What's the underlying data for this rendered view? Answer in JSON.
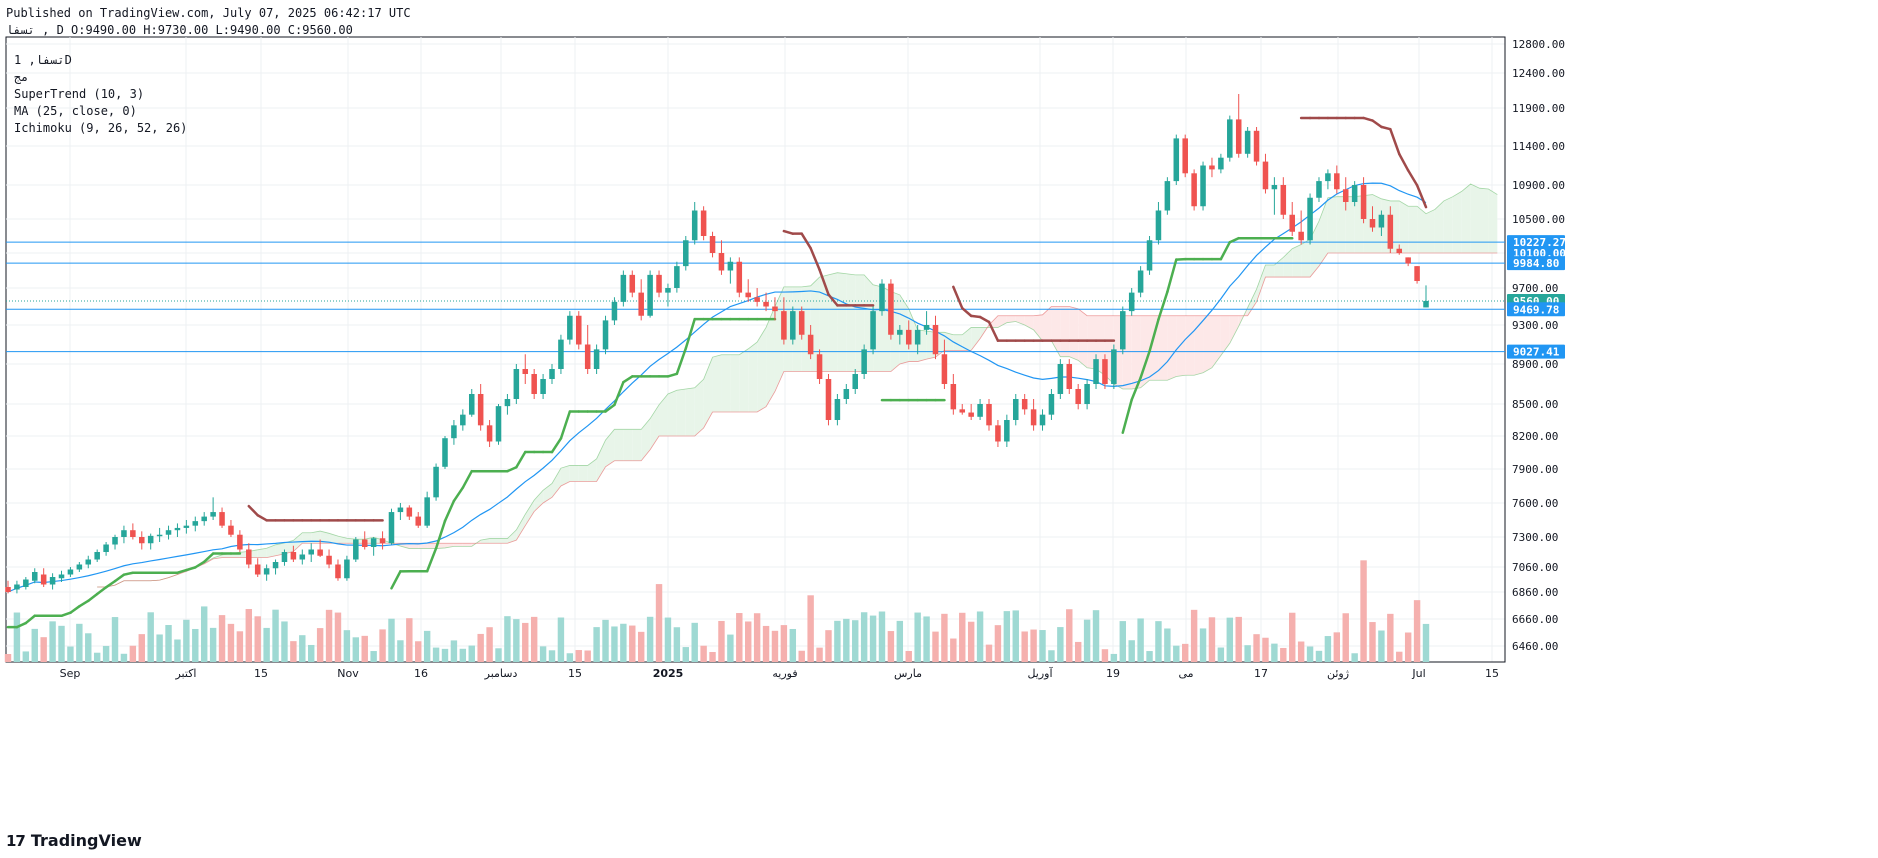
{
  "header": {
    "published": "Published on TradingView.com, July 07, 2025 06:42:17 UTC",
    "ohlc_line": "تسفا , D O:9490.00 H:9730.00 L:9490.00 C:9560.00"
  },
  "legend": {
    "symbol": "تسفا, 1D",
    "exchange": "مج",
    "supertrend": "SuperTrend (10, 3)",
    "ma": "MA (25, close, 0)",
    "ichimoku": "Ichimoku (9, 26, 52, 26)"
  },
  "footer": {
    "logo_mark": "17",
    "logo_text": "TradingView"
  },
  "colors": {
    "up": "#26a69a",
    "down": "#ef5350",
    "supertrend_up": "#4caf50",
    "supertrend_down": "#a04a4a",
    "ma": "#2196f3",
    "cloud_bull": "#e8f5e9",
    "cloud_bear": "#fde8e8",
    "level_line": "#2196f3",
    "grid": "#eef0f3"
  },
  "chart_data": {
    "type": "candlestick",
    "y_ticks": [
      "12800.00",
      "12400.00",
      "11900.00",
      "11400.00",
      "10900.00",
      "10500.00",
      "10100.00",
      "9700.00",
      "9300.00",
      "8900.00",
      "8500.00",
      "8200.00",
      "7900.00",
      "7600.00",
      "7300.00",
      "7060.00",
      "6860.00",
      "6660.00",
      "6460.00"
    ],
    "x_labels": [
      "Sep",
      "اکتبر",
      "15",
      "Nov",
      "16",
      "دسامبر",
      "15",
      "2025",
      "فوریه",
      "مارس",
      "آوریل",
      "19",
      "می",
      "17",
      "ژوئن",
      "Jul",
      "15"
    ],
    "price_labels": [
      {
        "value": "10227.27",
        "color": "#2196f3"
      },
      {
        "value": "10100.00",
        "color": "#2196f3"
      },
      {
        "value": "9984.80",
        "color": "#2196f3"
      },
      {
        "value": "9560.00",
        "color": "#26a69a"
      },
      {
        "value": "9469.78",
        "color": "#2196f3"
      },
      {
        "value": "9027.41",
        "color": "#2196f3"
      }
    ],
    "horizontal_levels": [
      10227.27,
      9984.8,
      9469.78,
      9027.41
    ],
    "last_close": 9560.0,
    "candles": [
      {
        "o": 6900,
        "h": 6950,
        "l": 6850,
        "c": 6860
      },
      {
        "o": 6880,
        "h": 6950,
        "l": 6850,
        "c": 6920
      },
      {
        "o": 6900,
        "h": 6980,
        "l": 6880,
        "c": 6960
      },
      {
        "o": 6950,
        "h": 7050,
        "l": 6930,
        "c": 7020
      },
      {
        "o": 7000,
        "h": 7050,
        "l": 6900,
        "c": 6920
      },
      {
        "o": 6920,
        "h": 7010,
        "l": 6880,
        "c": 6980
      },
      {
        "o": 6970,
        "h": 7030,
        "l": 6940,
        "c": 7000
      },
      {
        "o": 7000,
        "h": 7060,
        "l": 6980,
        "c": 7040
      },
      {
        "o": 7040,
        "h": 7100,
        "l": 7020,
        "c": 7080
      },
      {
        "o": 7080,
        "h": 7150,
        "l": 7050,
        "c": 7120
      },
      {
        "o": 7120,
        "h": 7200,
        "l": 7100,
        "c": 7180
      },
      {
        "o": 7180,
        "h": 7260,
        "l": 7150,
        "c": 7240
      },
      {
        "o": 7240,
        "h": 7320,
        "l": 7200,
        "c": 7300
      },
      {
        "o": 7300,
        "h": 7400,
        "l": 7250,
        "c": 7360
      },
      {
        "o": 7360,
        "h": 7420,
        "l": 7280,
        "c": 7300
      },
      {
        "o": 7300,
        "h": 7350,
        "l": 7200,
        "c": 7250
      },
      {
        "o": 7250,
        "h": 7330,
        "l": 7200,
        "c": 7310
      },
      {
        "o": 7310,
        "h": 7380,
        "l": 7260,
        "c": 7320
      },
      {
        "o": 7320,
        "h": 7400,
        "l": 7280,
        "c": 7360
      },
      {
        "o": 7360,
        "h": 7420,
        "l": 7300,
        "c": 7380
      },
      {
        "o": 7380,
        "h": 7450,
        "l": 7330,
        "c": 7400
      },
      {
        "o": 7400,
        "h": 7480,
        "l": 7350,
        "c": 7440
      },
      {
        "o": 7440,
        "h": 7520,
        "l": 7400,
        "c": 7480
      },
      {
        "o": 7480,
        "h": 7650,
        "l": 7450,
        "c": 7520
      },
      {
        "o": 7520,
        "h": 7560,
        "l": 7380,
        "c": 7400
      },
      {
        "o": 7400,
        "h": 7450,
        "l": 7300,
        "c": 7320
      },
      {
        "o": 7320,
        "h": 7360,
        "l": 7180,
        "c": 7200
      },
      {
        "o": 7200,
        "h": 7250,
        "l": 7050,
        "c": 7080
      },
      {
        "o": 7080,
        "h": 7130,
        "l": 6980,
        "c": 7000
      },
      {
        "o": 7000,
        "h": 7080,
        "l": 6950,
        "c": 7050
      },
      {
        "o": 7050,
        "h": 7120,
        "l": 7000,
        "c": 7100
      },
      {
        "o": 7100,
        "h": 7200,
        "l": 7070,
        "c": 7180
      },
      {
        "o": 7180,
        "h": 7230,
        "l": 7100,
        "c": 7120
      },
      {
        "o": 7120,
        "h": 7200,
        "l": 7080,
        "c": 7160
      },
      {
        "o": 7160,
        "h": 7250,
        "l": 7100,
        "c": 7200
      },
      {
        "o": 7200,
        "h": 7280,
        "l": 7140,
        "c": 7150
      },
      {
        "o": 7150,
        "h": 7200,
        "l": 7050,
        "c": 7080
      },
      {
        "o": 7080,
        "h": 7120,
        "l": 6950,
        "c": 6970
      },
      {
        "o": 6970,
        "h": 7150,
        "l": 6950,
        "c": 7120
      },
      {
        "o": 7120,
        "h": 7300,
        "l": 7100,
        "c": 7280
      },
      {
        "o": 7280,
        "h": 7350,
        "l": 7200,
        "c": 7220
      },
      {
        "o": 7220,
        "h": 7300,
        "l": 7150,
        "c": 7290
      },
      {
        "o": 7290,
        "h": 7350,
        "l": 7200,
        "c": 7250
      },
      {
        "o": 7250,
        "h": 7550,
        "l": 7240,
        "c": 7520
      },
      {
        "o": 7520,
        "h": 7600,
        "l": 7450,
        "c": 7560
      },
      {
        "o": 7560,
        "h": 7580,
        "l": 7450,
        "c": 7480
      },
      {
        "o": 7480,
        "h": 7520,
        "l": 7380,
        "c": 7400
      },
      {
        "o": 7400,
        "h": 7700,
        "l": 7380,
        "c": 7650
      },
      {
        "o": 7650,
        "h": 7950,
        "l": 7620,
        "c": 7920
      },
      {
        "o": 7920,
        "h": 8200,
        "l": 7900,
        "c": 8180
      },
      {
        "o": 8180,
        "h": 8350,
        "l": 8120,
        "c": 8300
      },
      {
        "o": 8300,
        "h": 8450,
        "l": 8250,
        "c": 8400
      },
      {
        "o": 8400,
        "h": 8650,
        "l": 8380,
        "c": 8600
      },
      {
        "o": 8600,
        "h": 8700,
        "l": 8250,
        "c": 8300
      },
      {
        "o": 8300,
        "h": 8350,
        "l": 8100,
        "c": 8150
      },
      {
        "o": 8150,
        "h": 8500,
        "l": 8120,
        "c": 8480
      },
      {
        "o": 8480,
        "h": 8600,
        "l": 8400,
        "c": 8550
      },
      {
        "o": 8550,
        "h": 8900,
        "l": 8500,
        "c": 8850
      },
      {
        "o": 8850,
        "h": 9000,
        "l": 8700,
        "c": 8800
      },
      {
        "o": 8800,
        "h": 8850,
        "l": 8550,
        "c": 8600
      },
      {
        "o": 8600,
        "h": 8800,
        "l": 8550,
        "c": 8750
      },
      {
        "o": 8750,
        "h": 8900,
        "l": 8700,
        "c": 8850
      },
      {
        "o": 8850,
        "h": 9200,
        "l": 8800,
        "c": 9150
      },
      {
        "o": 9150,
        "h": 9450,
        "l": 9100,
        "c": 9400
      },
      {
        "o": 9400,
        "h": 9450,
        "l": 9050,
        "c": 9100
      },
      {
        "o": 9100,
        "h": 9300,
        "l": 8800,
        "c": 8850
      },
      {
        "o": 8850,
        "h": 9100,
        "l": 8800,
        "c": 9050
      },
      {
        "o": 9050,
        "h": 9400,
        "l": 9000,
        "c": 9350
      },
      {
        "o": 9350,
        "h": 9600,
        "l": 9300,
        "c": 9550
      },
      {
        "o": 9550,
        "h": 9900,
        "l": 9500,
        "c": 9850
      },
      {
        "o": 9850,
        "h": 9900,
        "l": 9600,
        "c": 9650
      },
      {
        "o": 9650,
        "h": 9800,
        "l": 9350,
        "c": 9400
      },
      {
        "o": 9400,
        "h": 9900,
        "l": 9380,
        "c": 9850
      },
      {
        "o": 9850,
        "h": 9900,
        "l": 9600,
        "c": 9650
      },
      {
        "o": 9650,
        "h": 9750,
        "l": 9500,
        "c": 9700
      },
      {
        "o": 9700,
        "h": 10000,
        "l": 9650,
        "c": 9950
      },
      {
        "o": 9950,
        "h": 10300,
        "l": 9900,
        "c": 10250
      },
      {
        "o": 10250,
        "h": 10700,
        "l": 10200,
        "c": 10600
      },
      {
        "o": 10600,
        "h": 10650,
        "l": 10250,
        "c": 10300
      },
      {
        "o": 10300,
        "h": 10350,
        "l": 10050,
        "c": 10100
      },
      {
        "o": 10100,
        "h": 10250,
        "l": 9850,
        "c": 9900
      },
      {
        "o": 9900,
        "h": 10050,
        "l": 9750,
        "c": 10000
      },
      {
        "o": 10000,
        "h": 10050,
        "l": 9600,
        "c": 9650
      },
      {
        "o": 9650,
        "h": 9800,
        "l": 9550,
        "c": 9600
      },
      {
        "o": 9600,
        "h": 9700,
        "l": 9500,
        "c": 9550
      },
      {
        "o": 9550,
        "h": 9650,
        "l": 9450,
        "c": 9500
      },
      {
        "o": 9500,
        "h": 9600,
        "l": 9350,
        "c": 9450
      },
      {
        "o": 9450,
        "h": 9600,
        "l": 9100,
        "c": 9150
      },
      {
        "o": 9150,
        "h": 9500,
        "l": 9100,
        "c": 9450
      },
      {
        "o": 9450,
        "h": 9500,
        "l": 9150,
        "c": 9200
      },
      {
        "o": 9200,
        "h": 9300,
        "l": 8950,
        "c": 9000
      },
      {
        "o": 9000,
        "h": 9050,
        "l": 8700,
        "c": 8750
      },
      {
        "o": 8750,
        "h": 8800,
        "l": 8300,
        "c": 8350
      },
      {
        "o": 8350,
        "h": 8600,
        "l": 8300,
        "c": 8550
      },
      {
        "o": 8550,
        "h": 8700,
        "l": 8500,
        "c": 8650
      },
      {
        "o": 8650,
        "h": 8850,
        "l": 8600,
        "c": 8800
      },
      {
        "o": 8800,
        "h": 9100,
        "l": 8750,
        "c": 9050
      },
      {
        "o": 9050,
        "h": 9500,
        "l": 9000,
        "c": 9450
      },
      {
        "o": 9450,
        "h": 9800,
        "l": 9400,
        "c": 9750
      },
      {
        "o": 9750,
        "h": 9800,
        "l": 9150,
        "c": 9200
      },
      {
        "o": 9200,
        "h": 9300,
        "l": 9100,
        "c": 9250
      },
      {
        "o": 9250,
        "h": 9350,
        "l": 9050,
        "c": 9100
      },
      {
        "o": 9100,
        "h": 9300,
        "l": 9000,
        "c": 9250
      },
      {
        "o": 9250,
        "h": 9450,
        "l": 9200,
        "c": 9300
      },
      {
        "o": 9300,
        "h": 9400,
        "l": 8950,
        "c": 9000
      },
      {
        "o": 9000,
        "h": 9150,
        "l": 8650,
        "c": 8700
      },
      {
        "o": 8700,
        "h": 8800,
        "l": 8400,
        "c": 8450
      },
      {
        "o": 8450,
        "h": 8500,
        "l": 8400,
        "c": 8420
      },
      {
        "o": 8420,
        "h": 8500,
        "l": 8350,
        "c": 8380
      },
      {
        "o": 8380,
        "h": 8550,
        "l": 8350,
        "c": 8500
      },
      {
        "o": 8500,
        "h": 8550,
        "l": 8250,
        "c": 8300
      },
      {
        "o": 8300,
        "h": 8350,
        "l": 8100,
        "c": 8150
      },
      {
        "o": 8150,
        "h": 8400,
        "l": 8100,
        "c": 8350
      },
      {
        "o": 8350,
        "h": 8600,
        "l": 8300,
        "c": 8550
      },
      {
        "o": 8550,
        "h": 8600,
        "l": 8400,
        "c": 8450
      },
      {
        "o": 8450,
        "h": 8550,
        "l": 8250,
        "c": 8300
      },
      {
        "o": 8300,
        "h": 8450,
        "l": 8250,
        "c": 8400
      },
      {
        "o": 8400,
        "h": 8650,
        "l": 8350,
        "c": 8600
      },
      {
        "o": 8600,
        "h": 8950,
        "l": 8550,
        "c": 8900
      },
      {
        "o": 8900,
        "h": 8950,
        "l": 8600,
        "c": 8650
      },
      {
        "o": 8650,
        "h": 8700,
        "l": 8450,
        "c": 8500
      },
      {
        "o": 8500,
        "h": 8750,
        "l": 8450,
        "c": 8700
      },
      {
        "o": 8700,
        "h": 9000,
        "l": 8650,
        "c": 8950
      },
      {
        "o": 8950,
        "h": 9000,
        "l": 8650,
        "c": 8700
      },
      {
        "o": 8700,
        "h": 9100,
        "l": 8650,
        "c": 9050
      },
      {
        "o": 9050,
        "h": 9500,
        "l": 9000,
        "c": 9450
      },
      {
        "o": 9450,
        "h": 9700,
        "l": 9400,
        "c": 9650
      },
      {
        "o": 9650,
        "h": 9950,
        "l": 9600,
        "c": 9900
      },
      {
        "o": 9900,
        "h": 10300,
        "l": 9850,
        "c": 10250
      },
      {
        "o": 10250,
        "h": 10700,
        "l": 10200,
        "c": 10600
      },
      {
        "o": 10600,
        "h": 11000,
        "l": 10550,
        "c": 10950
      },
      {
        "o": 10950,
        "h": 11550,
        "l": 10900,
        "c": 11500
      },
      {
        "o": 11500,
        "h": 11550,
        "l": 11000,
        "c": 11050
      },
      {
        "o": 11050,
        "h": 11100,
        "l": 10600,
        "c": 10650
      },
      {
        "o": 10650,
        "h": 11200,
        "l": 10600,
        "c": 11150
      },
      {
        "o": 11150,
        "h": 11250,
        "l": 11000,
        "c": 11100
      },
      {
        "o": 11100,
        "h": 11300,
        "l": 11050,
        "c": 11250
      },
      {
        "o": 11250,
        "h": 11800,
        "l": 11200,
        "c": 11750
      },
      {
        "o": 11750,
        "h": 12100,
        "l": 11250,
        "c": 11300
      },
      {
        "o": 11300,
        "h": 11650,
        "l": 11250,
        "c": 11600
      },
      {
        "o": 11600,
        "h": 11650,
        "l": 11150,
        "c": 11200
      },
      {
        "o": 11200,
        "h": 11300,
        "l": 10800,
        "c": 10850
      },
      {
        "o": 10850,
        "h": 11000,
        "l": 10550,
        "c": 10900
      },
      {
        "o": 10900,
        "h": 11000,
        "l": 10500,
        "c": 10550
      },
      {
        "o": 10550,
        "h": 10700,
        "l": 10300,
        "c": 10350
      },
      {
        "o": 10350,
        "h": 10600,
        "l": 10200,
        "c": 10250
      },
      {
        "o": 10250,
        "h": 10800,
        "l": 10200,
        "c": 10750
      },
      {
        "o": 10750,
        "h": 11000,
        "l": 10700,
        "c": 10950
      },
      {
        "o": 10950,
        "h": 11100,
        "l": 10850,
        "c": 11050
      },
      {
        "o": 11050,
        "h": 11150,
        "l": 10800,
        "c": 10850
      },
      {
        "o": 10850,
        "h": 11000,
        "l": 10600,
        "c": 10700
      },
      {
        "o": 10700,
        "h": 10950,
        "l": 10650,
        "c": 10900
      },
      {
        "o": 10900,
        "h": 11000,
        "l": 10450,
        "c": 10500
      },
      {
        "o": 10500,
        "h": 10650,
        "l": 10350,
        "c": 10400
      },
      {
        "o": 10400,
        "h": 10600,
        "l": 10300,
        "c": 10550
      },
      {
        "o": 10550,
        "h": 10650,
        "l": 10100,
        "c": 10150
      },
      {
        "o": 10150,
        "h": 10200,
        "l": 10080,
        "c": 10100
      },
      {
        "o": 10050,
        "h": 10050,
        "l": 9950,
        "c": 9980
      },
      {
        "o": 9950,
        "h": 9950,
        "l": 9750,
        "c": 9780
      },
      {
        "o": 9490,
        "h": 9730,
        "l": 9490,
        "c": 9560
      }
    ]
  }
}
